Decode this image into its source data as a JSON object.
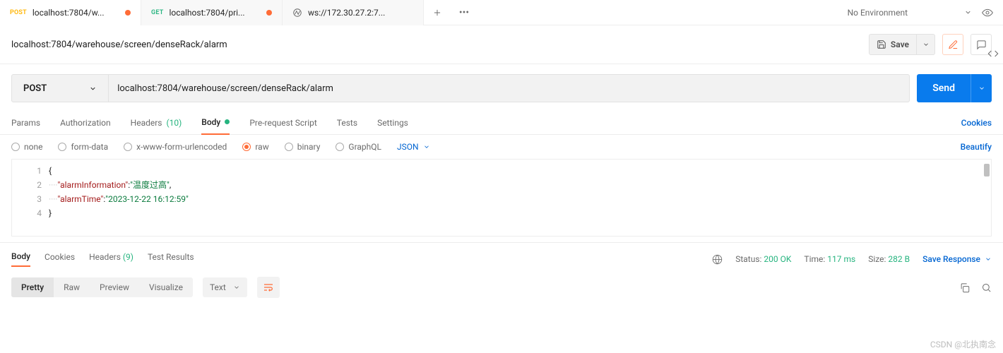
{
  "tabs": [
    {
      "method": "POST",
      "title": "localhost:7804/w...",
      "dirty": true
    },
    {
      "method": "GET",
      "title": "localhost:7804/pri...",
      "dirty": true
    },
    {
      "ws": true,
      "title": "ws://172.30.27.2:7..."
    }
  ],
  "env": {
    "label": "No Environment"
  },
  "request": {
    "title": "localhost:7804/warehouse/screen/denseRack/alarm",
    "method": "POST",
    "url": "localhost:7804/warehouse/screen/denseRack/alarm",
    "save": "Save",
    "send": "Send"
  },
  "subTabs": {
    "params": "Params",
    "auth": "Authorization",
    "headers": "Headers",
    "headersCount": "(10)",
    "body": "Body",
    "prereq": "Pre-request Script",
    "tests": "Tests",
    "settings": "Settings",
    "cookies": "Cookies"
  },
  "bodyOpts": {
    "none": "none",
    "formData": "form-data",
    "xwww": "x-www-form-urlencoded",
    "raw": "raw",
    "binary": "binary",
    "graphql": "GraphQL",
    "lang": "JSON",
    "beautify": "Beautify"
  },
  "code": {
    "lines": [
      "1",
      "2",
      "3",
      "4"
    ],
    "row1": "{",
    "row2_key": "\"alarmInformation\"",
    "row2_val": "\"温度过高\"",
    "row3_key": "\"alarmTime\"",
    "row3_val": "\"2023-12-22 16:12:59\"",
    "row4": "}"
  },
  "respTabs": {
    "body": "Body",
    "cookies": "Cookies",
    "headers": "Headers",
    "headersCount": "(9)",
    "testResults": "Test Results"
  },
  "respMeta": {
    "statusLabel": "Status:",
    "statusVal": "200 OK",
    "timeLabel": "Time:",
    "timeVal": "117 ms",
    "sizeLabel": "Size:",
    "sizeVal": "282 B",
    "saveResp": "Save Response"
  },
  "viewRow": {
    "pretty": "Pretty",
    "raw": "Raw",
    "preview": "Preview",
    "visualize": "Visualize",
    "fmt": "Text"
  },
  "watermark": "CSDN @北执南念"
}
